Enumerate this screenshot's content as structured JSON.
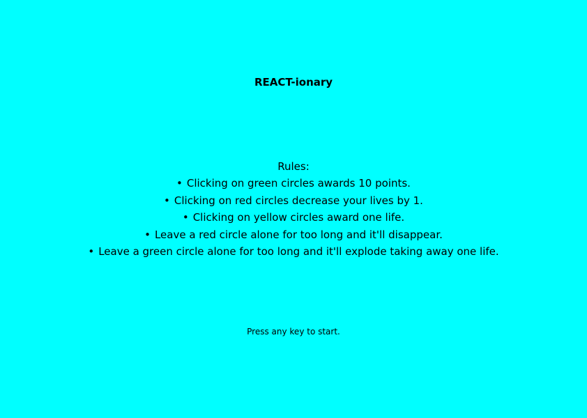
{
  "title": "REACT-ionary",
  "rules": {
    "heading": "Rules:",
    "bullet": "•",
    "items": [
      "Clicking on green circles awards 10 points.",
      "Clicking on red circles decrease your lives by 1.",
      "Clicking on yellow circles award one life.",
      "Leave a red circle alone for too long and it'll disappear.",
      "Leave a green circle alone for too long and it'll explode taking away one life."
    ]
  },
  "start_prompt": "Press any key to start.",
  "colors": {
    "background": "#00ffff",
    "text": "#000000"
  }
}
